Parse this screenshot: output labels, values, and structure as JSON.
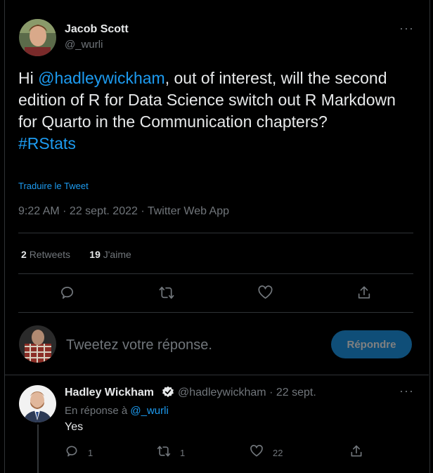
{
  "tweet": {
    "author_name": "Jacob Scott",
    "author_handle": "@_wurli",
    "text_before": "Hi ",
    "mention": "@hadleywickham",
    "text_after": ", out of interest, will the second edition of R for Data Science switch out R Markdown for Quarto in the Communication chapters?",
    "hashtag": "#RStats",
    "translate_label": "Traduire le Tweet",
    "meta": "9:22 AM · 22 sept. 2022 · Twitter Web App",
    "retweets_count": "2",
    "retweets_label": "Retweets",
    "likes_count": "19",
    "likes_label": "J'aime",
    "more_label": "···"
  },
  "compose": {
    "placeholder": "Tweetez votre réponse.",
    "button_label": "Répondre"
  },
  "reply": {
    "author_name": "Hadley Wickham",
    "author_handle": "@hadleywickham",
    "date": "· 22 sept.",
    "in_reply_prefix": "En réponse à",
    "in_reply_handle": "@_wurli",
    "text": "Yes",
    "replies_count": "1",
    "retweets_count": "1",
    "likes_count": "22",
    "more_label": "···"
  },
  "colors": {
    "background": "#000000",
    "accent": "#1d9bf0",
    "muted": "#71767b",
    "verified": "#e7e9ea"
  },
  "icons": [
    "reply-icon",
    "retweet-icon",
    "like-icon",
    "share-icon",
    "verified-badge-icon",
    "more-icon"
  ]
}
